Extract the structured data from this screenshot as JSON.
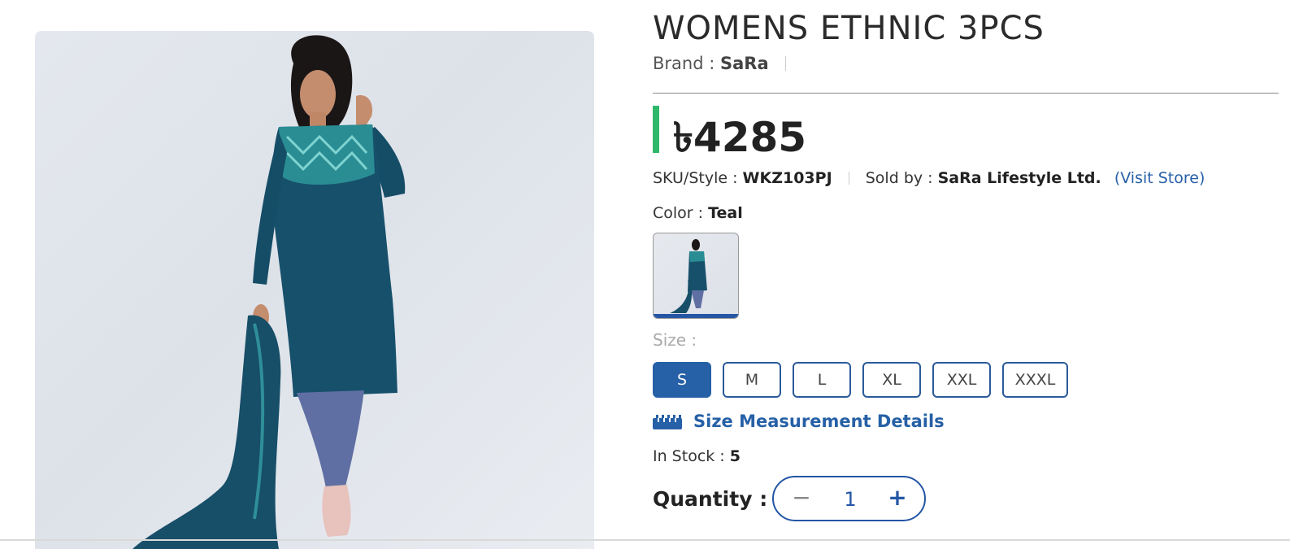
{
  "product": {
    "title": "WOMENS ETHNIC 3PCS",
    "brand_label": "Brand :",
    "brand": "SaRa",
    "currency_symbol": "৳",
    "price": "4285",
    "sku_label": "SKU/Style :",
    "sku": "WKZ103PJ",
    "sold_by_label": "Sold by :",
    "seller": "SaRa Lifestyle Ltd.",
    "visit_store": "(Visit Store)",
    "color_label": "Color :",
    "color": "Teal",
    "size_label": "Size :",
    "sizes": [
      "S",
      "M",
      "L",
      "XL",
      "XXL",
      "XXXL"
    ],
    "selected_size": "S",
    "size_measurement": "Size Measurement Details",
    "stock_label": "In Stock :",
    "stock": "5",
    "quantity_label": "Quantity :",
    "quantity": "1",
    "qty_minus": "−",
    "qty_plus": "+"
  },
  "colors": {
    "accent_blue": "#2660a6",
    "price_bar": "#2eb86a",
    "garment": "#17506b"
  }
}
